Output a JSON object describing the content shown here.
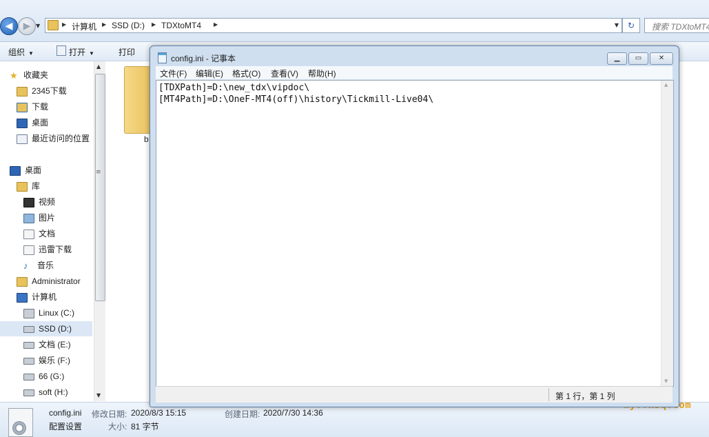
{
  "explorer": {
    "breadcrumbs": [
      "计算机",
      "SSD (D:)",
      "TDXtoMT4"
    ],
    "search_placeholder": "搜索 TDXtoMT4",
    "toolbar": {
      "organize": "组织",
      "open": "打开",
      "print": "打印"
    },
    "sidebar": {
      "favorites": "收藏夹",
      "favorites_items": [
        "2345下载",
        "下载",
        "桌面",
        "最近访问的位置"
      ],
      "desktop": "桌面",
      "libraries": "库",
      "library_items": [
        "视频",
        "图片",
        "文档",
        "迅雷下载",
        "音乐"
      ],
      "user": "Administrator",
      "computer": "计算机",
      "drives": [
        "Linux (C:)",
        "SSD (D:)",
        "文档 (E:)",
        "娱乐 (F:)",
        "66 (G:)",
        "soft (H:)"
      ]
    },
    "folder_label_partial": "b",
    "details": {
      "file_name": "config.ini",
      "file_type": "配置设置",
      "modified_label": "修改日期:",
      "modified_value": "2020/8/3 15:15",
      "created_label": "创建日期:",
      "created_value": "2020/7/30 14:36",
      "size_label": "大小:",
      "size_value": "81 字节"
    }
  },
  "notepad": {
    "title": "config.ini - 记事本",
    "menu": [
      "文件(F)",
      "编辑(E)",
      "格式(O)",
      "查看(V)",
      "帮助(H)"
    ],
    "lines": [
      "[TDXPath]=D:\\new_tdx\\vipdoc\\",
      "[MT4Path]=D:\\OneF-MT4(off)\\history\\Tickmill-Live04\\"
    ],
    "status": "第 1 行，第 1 列"
  },
  "watermark": "my.fx3q.com",
  "colors": {
    "chrome": "#dde8f5",
    "selection": "#dbe7f5",
    "watermark": "#e8a21b"
  }
}
